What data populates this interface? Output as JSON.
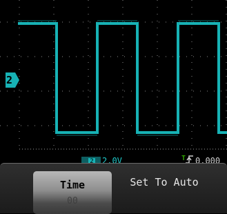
{
  "channel": {
    "number": "2",
    "color": "#17b2b5",
    "box_label": "2",
    "volts_readout": "2.0V"
  },
  "trigger": {
    "marker": "T",
    "readout": "0.000"
  },
  "softkeys": {
    "time_label": "Time",
    "time_sublabel": "00",
    "set_to_auto_label": "Set To Auto"
  },
  "colors": {
    "trace": "#17b2b5",
    "grid": "#c8c8c8",
    "trigger": "#2ea000",
    "background": "#000000"
  }
}
